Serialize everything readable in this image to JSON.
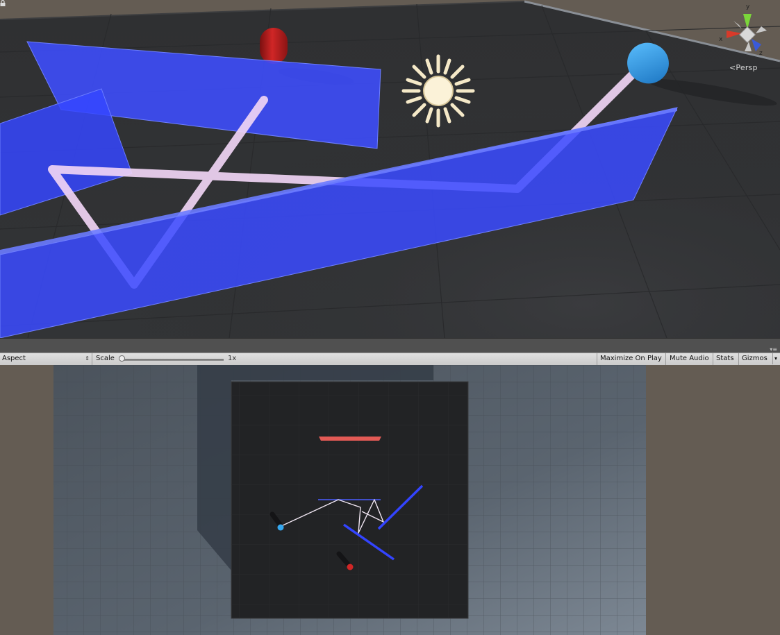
{
  "scene_view": {
    "projection_label": "Persp",
    "axis_labels": {
      "x": "x",
      "y": "y",
      "z": "z"
    },
    "icons": [
      "lock-icon",
      "sun-light-icon",
      "orientation-gizmo-icon"
    ]
  },
  "game_toolbar": {
    "aspect_label": "Aspect",
    "scale_label": "Scale",
    "scale_value": "1x",
    "maximize_on_play": "Maximize On Play",
    "mute_audio": "Mute Audio",
    "stats": "Stats",
    "gizmos": "Gizmos"
  },
  "colors": {
    "mirror_blue": "#3344ff",
    "laser": "#f0d4f4",
    "capsule_red": "#c01c1c",
    "capsule_blue": "#2e9be8",
    "floor": "#303133",
    "background": "#645c53"
  }
}
